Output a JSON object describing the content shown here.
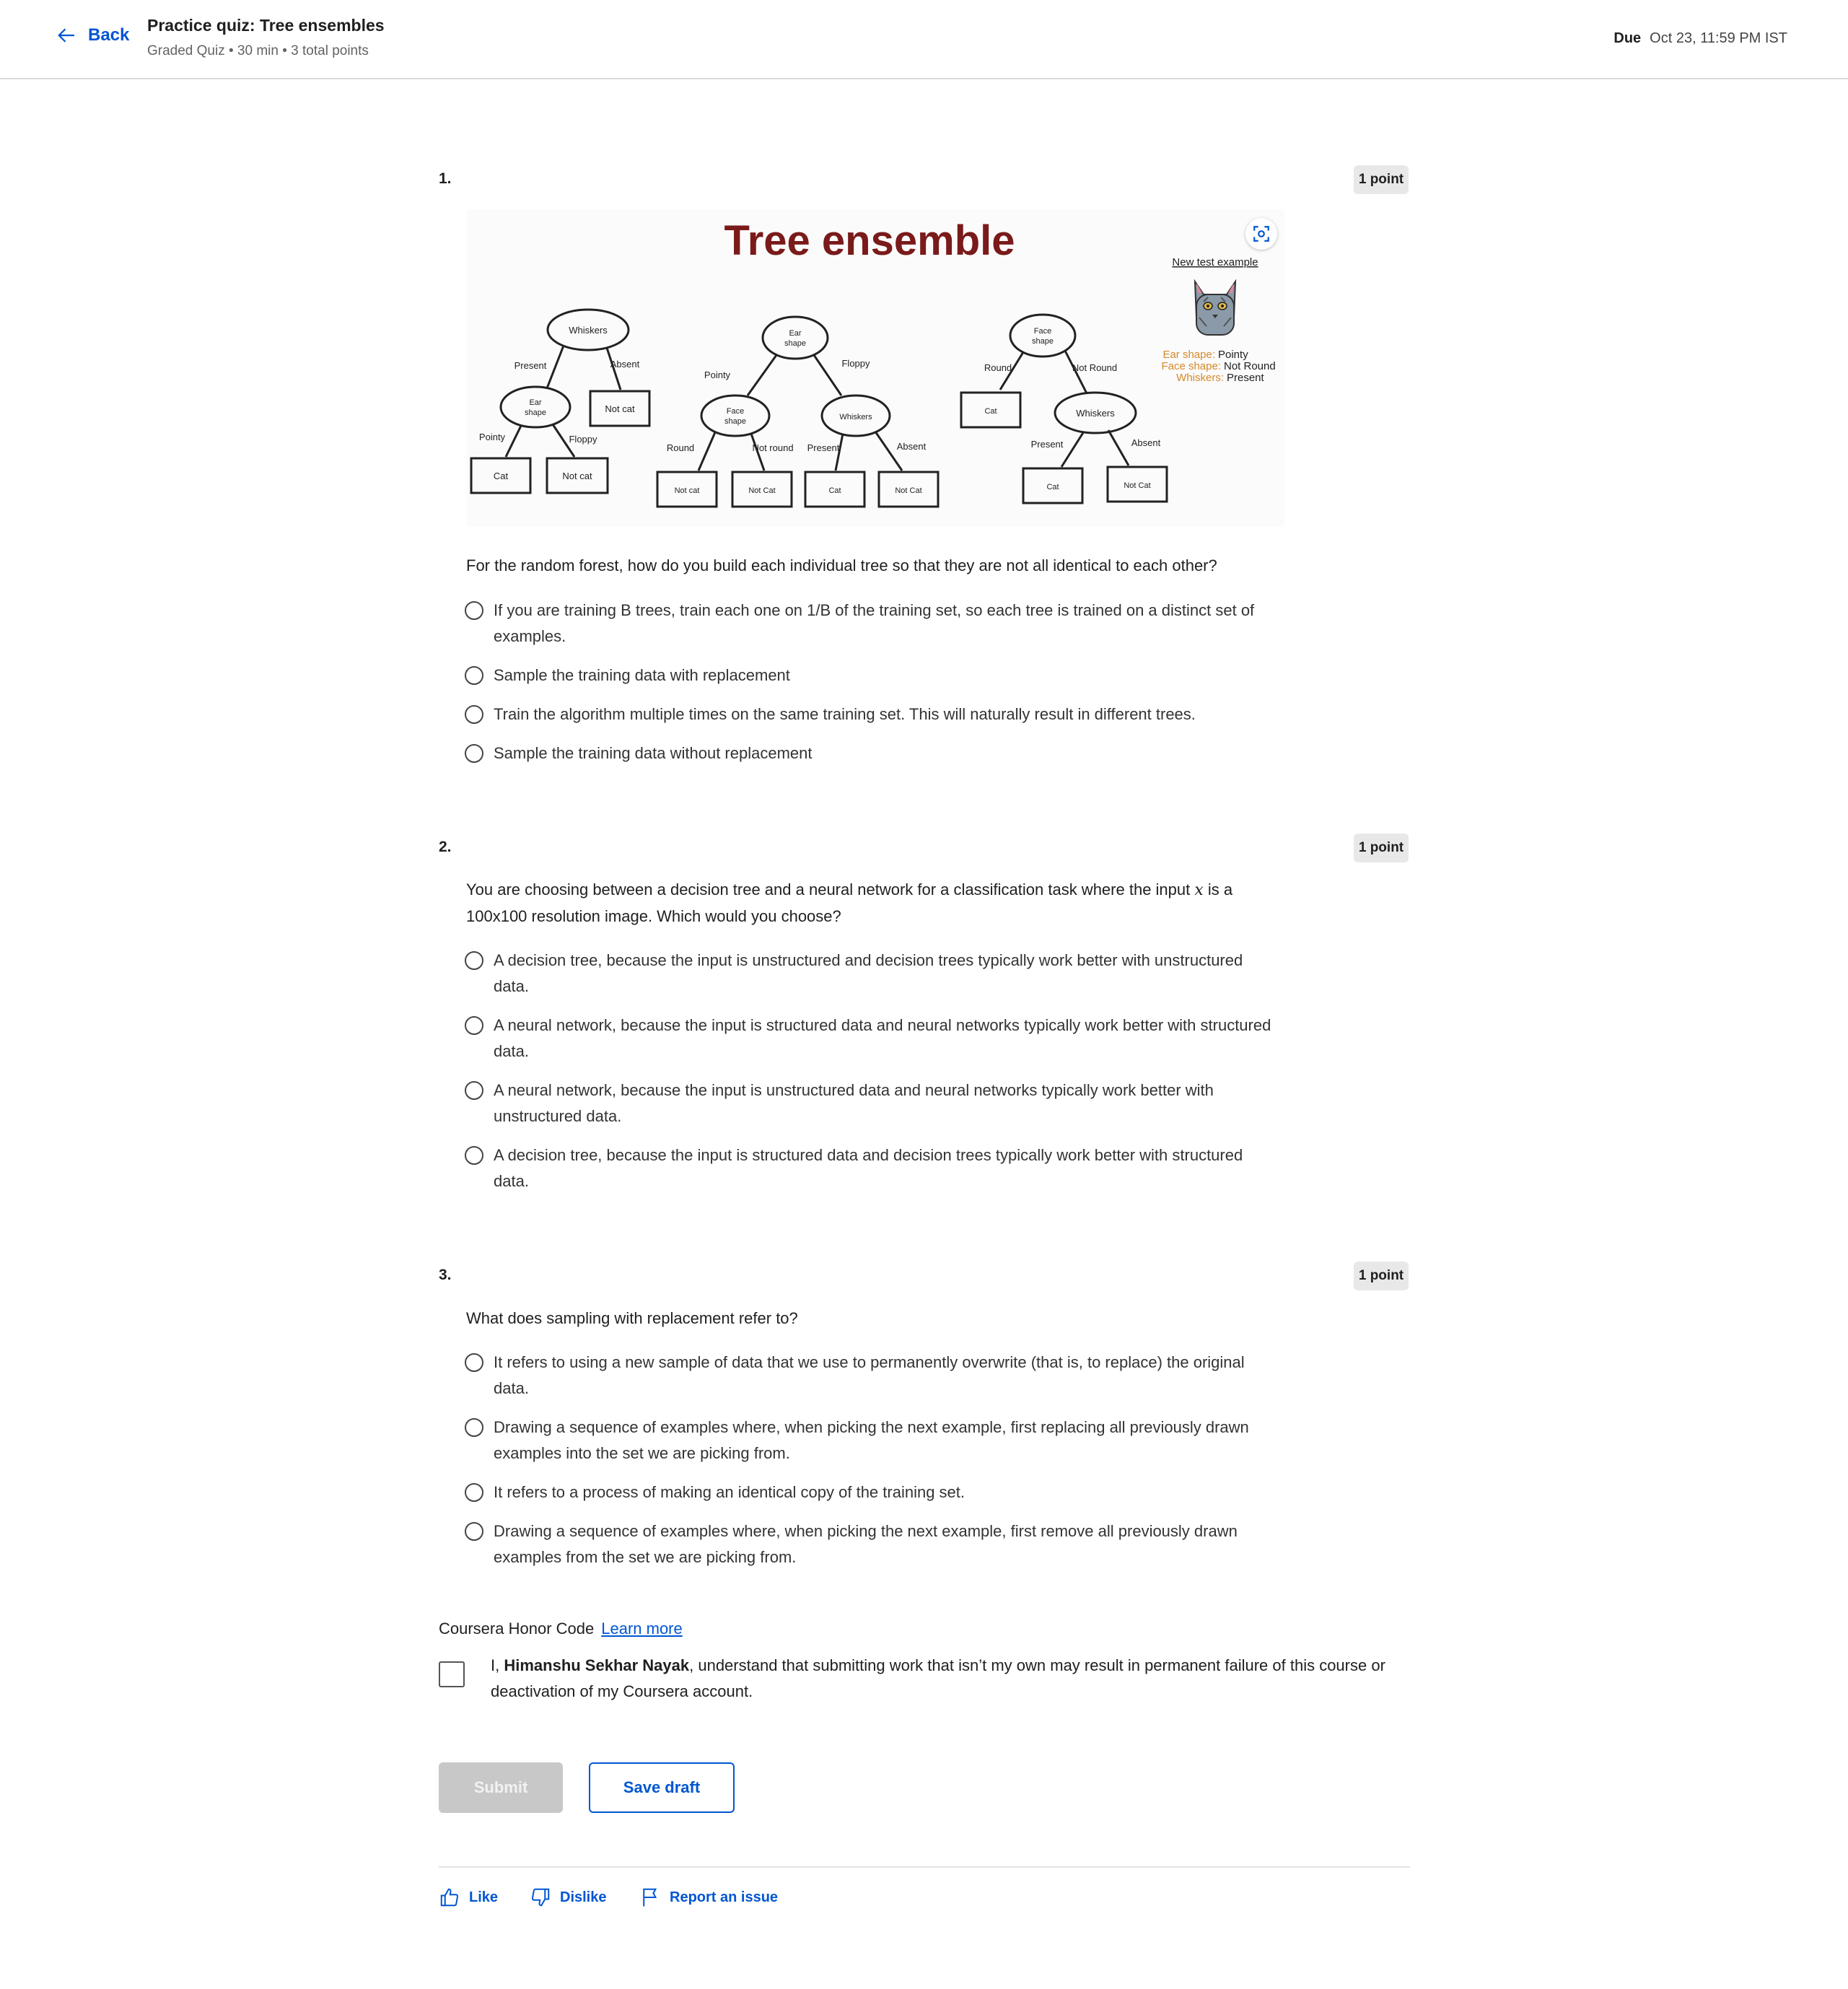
{
  "header": {
    "back_label": "Back",
    "title": "Practice quiz: Tree ensembles",
    "subtitle": "Graded Quiz • 30 min • 3 total points",
    "due_label": "Due",
    "due_value": "Oct 23, 11:59 PM IST"
  },
  "questions": [
    {
      "number": "1.",
      "points": "1 point",
      "figure": {
        "title": "Tree ensemble",
        "new_test_example": "New test example",
        "features": [
          {
            "name": "Ear shape:",
            "value": "Pointy"
          },
          {
            "name": "Face shape:",
            "value": "Not Round"
          },
          {
            "name": "Whiskers:",
            "value": "Present"
          }
        ],
        "tree1": {
          "root": "Whiskers",
          "left_edge": "Present",
          "right_edge": "Absent",
          "right_leaf": "Not cat",
          "sub": {
            "node_l1": "Ear",
            "node_l2": "shape",
            "left_edge": "Pointy",
            "right_edge": "Floppy",
            "left_leaf": "Cat",
            "right_leaf": "Not cat"
          }
        },
        "tree2": {
          "root_l1": "Ear",
          "root_l2": "shape",
          "left_edge": "Pointy",
          "right_edge": "Floppy",
          "left": {
            "node_l1": "Face",
            "node_l2": "shape",
            "left_edge": "Round",
            "right_edge": "Not round",
            "left_leaf": "Not cat",
            "right_leaf": "Not Cat"
          },
          "right": {
            "node": "Whiskers",
            "left_edge": "Present",
            "right_edge": "Absent",
            "left_leaf": "Cat",
            "right_leaf": "Not Cat"
          }
        },
        "tree3": {
          "root_l1": "Face",
          "root_l2": "shape",
          "left_edge": "Round",
          "right_edge": "Not Round",
          "left_leaf": "Cat",
          "right": {
            "node": "Whiskers",
            "left_edge": "Present",
            "right_edge": "Absent",
            "left_leaf": "Cat",
            "right_leaf": "Not Cat"
          }
        }
      },
      "text": "For the random forest, how do you build each individual tree so that they are not all identical to each other?",
      "options": [
        "If you are training B trees, train each one on 1/B of the training set, so each tree is trained on a distinct set of examples.",
        "Sample the training data with replacement",
        "Train the algorithm multiple times on the same training set. This will naturally result in different trees.",
        "Sample the training data without replacement"
      ]
    },
    {
      "number": "2.",
      "points": "1 point",
      "text_before": "You are choosing between a decision tree and a neural network for a classification task where the input ",
      "text_var": "x",
      "text_after": " is a 100x100 resolution image. Which would you choose?",
      "options": [
        "A decision tree, because the input is unstructured and decision trees typically work better with unstructured data.",
        "A neural network, because the input is structured data and neural networks typically work better with structured data.",
        "A neural network, because the input is unstructured data and neural networks typically work better with unstructured data.",
        "A decision tree, because the input is structured data and decision trees typically work better with structured data."
      ]
    },
    {
      "number": "3.",
      "points": "1 point",
      "text": "What does sampling with replacement refer to?",
      "options": [
        "It refers to using a new sample of data that we use to permanently overwrite (that is, to replace) the original data.",
        "Drawing a sequence of examples where, when picking the next example, first replacing all previously drawn examples into the set we are picking from.",
        "It refers to a process of making an identical copy of the training set.",
        "Drawing a sequence of examples where, when picking the next example, first remove all previously drawn examples from the set we are picking from."
      ]
    }
  ],
  "honor": {
    "title": "Coursera Honor Code",
    "learn_more": "Learn more",
    "prefix": "I, ",
    "name": "Himanshu Sekhar Nayak",
    "suffix": ", understand that submitting work that isn’t my own may result in permanent failure of this course or deactivation of my Coursera account."
  },
  "actions": {
    "submit": "Submit",
    "save_draft": "Save draft"
  },
  "footer": {
    "like": "Like",
    "dislike": "Dislike",
    "report": "Report an issue"
  },
  "colors": {
    "accent": "#0056d2",
    "figure_title": "#7a1a1a",
    "feature_name": "#d4892a"
  },
  "icons": [
    "arrow-left-icon",
    "expand-icon",
    "cat-image",
    "thumbs-up-icon",
    "thumbs-down-icon",
    "flag-icon"
  ]
}
